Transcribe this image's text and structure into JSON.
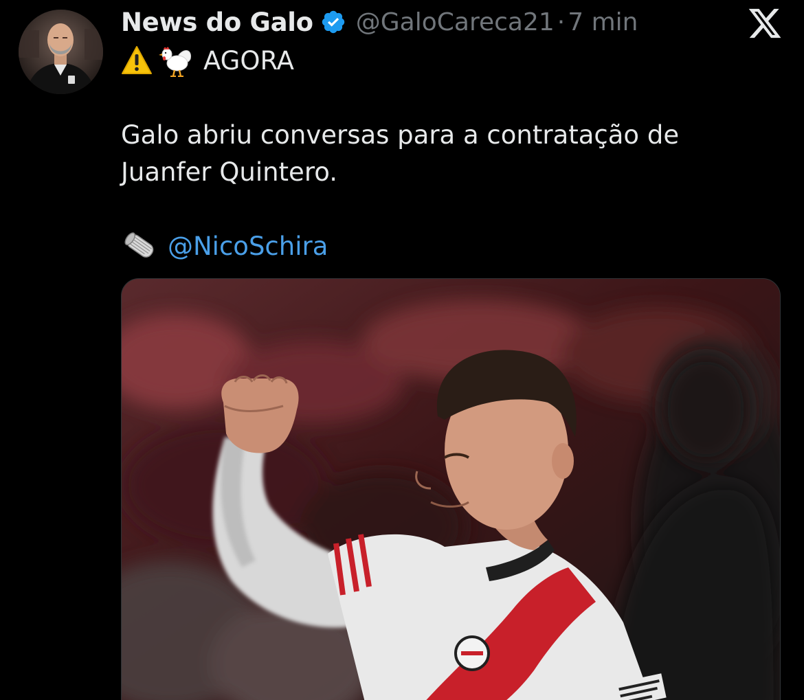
{
  "author": {
    "display_name": "News do Galo",
    "handle": "@GaloCareca21",
    "separator": "·",
    "time": "7 min",
    "verified": true,
    "avatar_icon": "coach-portrait-avatar"
  },
  "post": {
    "headline_emojis": [
      "warning-emoji",
      "rooster-emoji"
    ],
    "headline_text": "AGORA",
    "body_line_1": "Galo abriu conversas para a contratação de",
    "body_line_2": "Juanfer Quintero.",
    "source_icon": "newspaper-roll-emoji",
    "source_mention": "@NicoSchira"
  },
  "media": {
    "description_icon": "football-player-celebrating-photo"
  },
  "colors": {
    "background": "#000000",
    "text_primary": "#e7e9ea",
    "text_secondary": "#71767b",
    "link": "#4a9fe8",
    "verified_badge": "#1d9bf0"
  },
  "brand_icon": "x-logo-icon"
}
